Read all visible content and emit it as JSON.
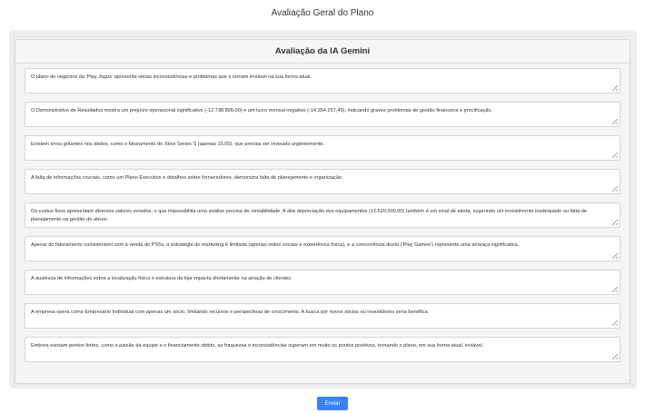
{
  "page": {
    "title": "Avaliação Geral do Plano"
  },
  "card": {
    "title": "Avaliação da IA Gemini"
  },
  "evaluations": [
    "O plano de negócios da 'Play Jogos' apresenta sérias inconsistências e problemas que o tornam inviável na sua forma atual.",
    "O Demonstrativo de Resultados mostra um prejuízo operacional significativo (-12.738.895,00) e um lucro mensal negativo (-14.354.257,49), indicando graves problemas de gestão financeira e precificação.",
    "Existem erros gritantes nos dados, como o faturamento do Xbox Series S (apenas 15,00), que precisa ser revisado urgentemente.",
    "A falta de informações cruciais, como um Plano Executivo e detalhes sobre fornecedores, demonstra falta de planejamento e organização.",
    "Os custos fixos apresentam diversos valores zerados, o que impossibilita uma análise precisa de rentabilidade. A alta depreciação dos equipamentos (12.620.000,00) também é um sinal de alerta, sugerindo um investimento inadequado ou falta de planejamento na gestão de ativos.",
    "Apesar do faturamento considerável com a venda de PS5s, a estratégia de marketing é limitada (apenas redes sociais e experiência física), e a concorrência direta ('Play Games') representa uma ameaça significativa.",
    "A ausência de informações sobre a localização física e estrutura da loja impacta diretamente na atração de clientes.",
    "A empresa opera como Empresário Individual com apenas um sócio, limitando recursos e perspectivas de crescimento.  A busca por novos sócios ou investidores seria benéfica.",
    "Embora existam pontos fortes, como a paixão da equipe e o financiamento obtido, as fraquezas e inconsistências superam em muito os pontos positivos, tornando o plano, em sua forma atual, inviável."
  ],
  "actions": {
    "submit_label": "Enviar"
  },
  "colors": {
    "accent": "#3b82f6"
  }
}
